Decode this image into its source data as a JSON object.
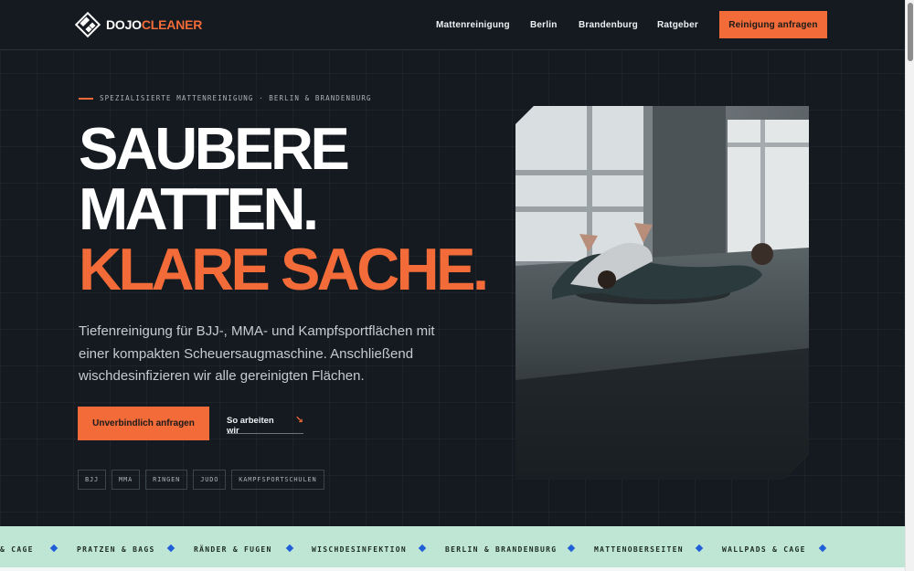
{
  "logo": {
    "part1": "DOJO",
    "part2": "CLEANER"
  },
  "nav": {
    "items": [
      "Mattenreinigung",
      "Berlin",
      "Brandenburg",
      "Ratgeber"
    ],
    "cta": "Reinigung anfragen"
  },
  "hero": {
    "eyebrow": "SPEZIALISIERTE MATTENREINIGUNG · BERLIN & BRANDENBURG",
    "headline_line1": "SAUBERE",
    "headline_line2": "MATTEN.",
    "headline_line3": "KLARE SACHE.",
    "lead": "Tiefenreinigung für BJJ-, MMA- und Kampfsportflächen mit einer kompakten Scheuersaugmaschine. Anschließend wischdesinfizieren wir alle gereinigten Flächen.",
    "primary_button": "Unverbindlich anfragen",
    "secondary_link": "So arbeiten wir",
    "tags": [
      "BJJ",
      "MMA",
      "RINGEN",
      "JUDO",
      "KAMPFSPORTSCHULEN"
    ]
  },
  "ticker": {
    "items": [
      "& CAGE",
      "PRATZEN & BAGS",
      "RÄNDER & FUGEN",
      "WISCHDESINFEKTION",
      "BERLIN & BRANDENBURG",
      "MATTENOBERSEITEN",
      "WALLPADS & CAGE"
    ]
  },
  "colors": {
    "accent": "#f26b38",
    "background": "#141a1f",
    "ticker_bg": "#bfe6d4",
    "ticker_diamond": "#1f5fd8"
  },
  "icons": {
    "logo": "diamond-logo-icon",
    "link_arrow": "arrow-down-right-icon",
    "ticker_separator": "diamond-icon"
  }
}
